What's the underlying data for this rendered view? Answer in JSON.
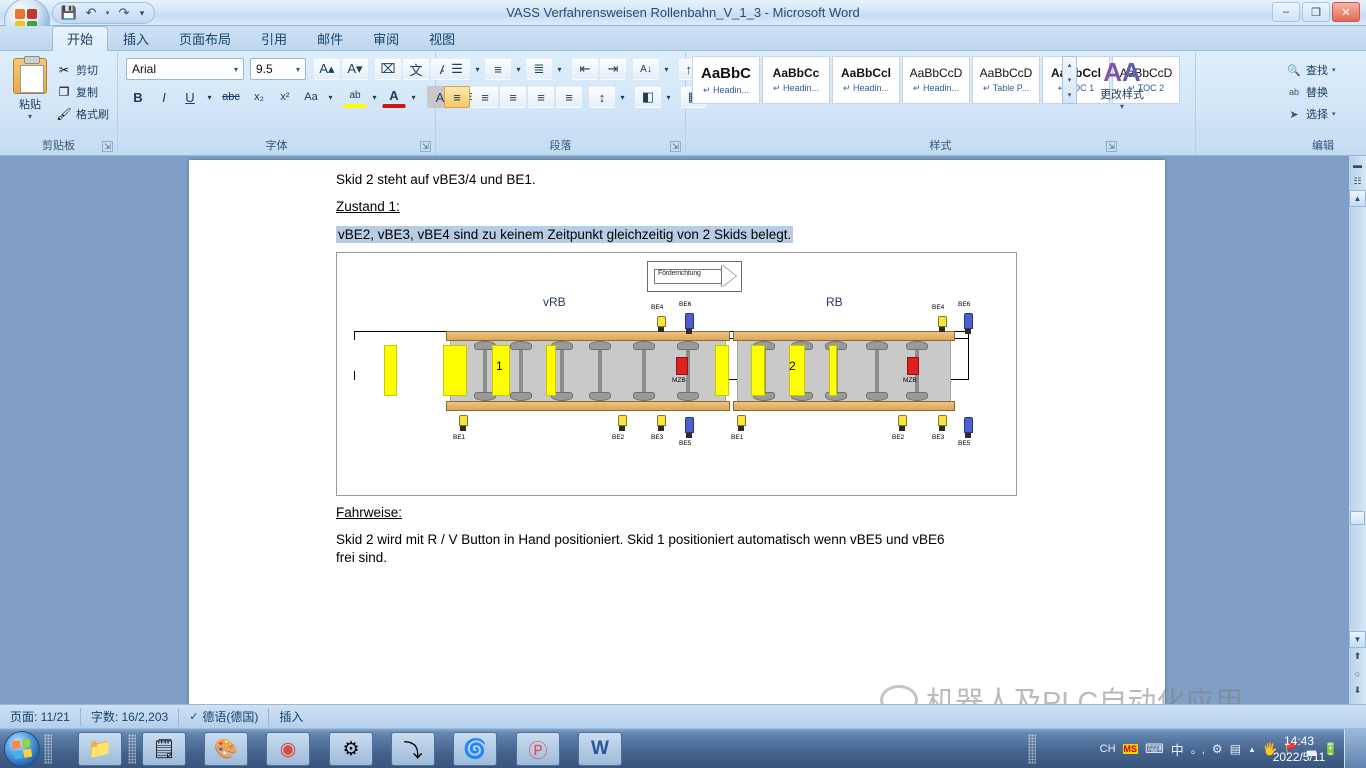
{
  "window": {
    "title": "VASS Verfahrensweisen Rollenbahn_V_1_3 - Microsoft Word",
    "minimize": "–",
    "maximize": "❐",
    "close": "✕"
  },
  "quick_access": {
    "save": "💾",
    "undo": "↶",
    "undo_arrow": "▾",
    "redo": "↷",
    "customize": "▾"
  },
  "ribbon": {
    "tabs": [
      {
        "label": "开始",
        "active": true
      },
      {
        "label": "插入",
        "active": false
      },
      {
        "label": "页面布局",
        "active": false
      },
      {
        "label": "引用",
        "active": false
      },
      {
        "label": "邮件",
        "active": false
      },
      {
        "label": "审阅",
        "active": false
      },
      {
        "label": "视图",
        "active": false
      }
    ],
    "clipboard": {
      "group_label": "剪贴板",
      "paste": "粘贴",
      "paste_arrow": "▾",
      "cut": "剪切",
      "copy": "复制",
      "format_painter": "格式刷",
      "cut_icon": "✂",
      "copy_icon": "❐",
      "painter_icon": "🖌"
    },
    "font": {
      "group_label": "字体",
      "font_name": "Arial",
      "font_size": "9.5",
      "grow": "A▴",
      "shrink": "A▾",
      "clear_format": "⌧",
      "phonetic": "文",
      "char_border": "A",
      "bold": "B",
      "italic": "I",
      "underline": "U",
      "underline_arrow": "▾",
      "strike": "abc",
      "subscript": "x₂",
      "superscript": "x²",
      "change_case": "Aa",
      "case_arrow": "▾",
      "highlight": "ab",
      "highlight_arrow": "▾",
      "font_color": "A",
      "color_arrow": "▾",
      "shading_char": "A",
      "enclose_char": "字"
    },
    "paragraph": {
      "group_label": "段落",
      "bullets": "☰",
      "numbering": "≡",
      "multilevel": "≣",
      "decrease_indent": "⇤",
      "increase_indent": "⇥",
      "sort": "↑↓",
      "sort_az": "A↓",
      "show_marks": "¶",
      "align_left": "≡",
      "align_center": "≡",
      "align_right": "≡",
      "justify": "≡",
      "distribute": "≡",
      "line_spacing": "↕",
      "shading": "◧",
      "borders": "▦",
      "arrow": "▾"
    },
    "styles": {
      "group_label": "样式",
      "items": [
        {
          "preview": "AaBbC",
          "name": "↵ Headin...",
          "bold": true,
          "big": true
        },
        {
          "preview": "AaBbCc",
          "name": "↵ Headin...",
          "bold": true,
          "big": true
        },
        {
          "preview": "AaBbCcl",
          "name": "↵ Headin...",
          "bold": true,
          "big": false
        },
        {
          "preview": "AaBbCcD",
          "name": "↵ Headin...",
          "bold": false,
          "big": false
        },
        {
          "preview": "AaBbCcD",
          "name": "↵ Table P...",
          "bold": false,
          "big": false
        },
        {
          "preview": "AaBbCcl",
          "name": "↵ TOC 1",
          "bold": true,
          "big": false
        },
        {
          "preview": "AaBbCcD",
          "name": "↵ TOC 2",
          "bold": false,
          "big": false
        }
      ],
      "scroll_up": "▴",
      "scroll_down": "▾",
      "more": "▾",
      "change_styles": "更改样式",
      "change_styles_arrow": "▾"
    },
    "editing": {
      "group_label": "编辑",
      "find": "查找",
      "find_icon": "🔍",
      "find_arrow": "▾",
      "replace": "替换",
      "replace_icon": "ab",
      "select": "选择",
      "select_icon": "➤",
      "select_arrow": "▾"
    }
  },
  "document": {
    "line1": "Skid 2 steht  auf vBE3/4 und  BE1.",
    "line2": "Zustand 1:",
    "line3": "vBE2, vBE3, vBE4 sind  zu keinem Zeitpunkt  gleichzeitig  von 2 Skids belegt.",
    "line4": "Fahrweise:",
    "line5": "Skid 2 wird mit R / V Button in Hand positioniert.  Skid 1 positioniert  automatisch wenn  vBE5 und  vBE6",
    "line6": "frei sind."
  },
  "diagram": {
    "direction_label": "Förderrichtung",
    "left_conveyor_label": "vRB",
    "right_conveyor_label": "RB",
    "left_skid_number": "1",
    "right_skid_number": "2",
    "motor_label_left": "MZB",
    "motor_label_right": "MZB",
    "sensors_left": [
      "BE1",
      "BE2",
      "BE3",
      "BE4",
      "BE5",
      "BE6"
    ],
    "sensors_right": [
      "BE1",
      "BE2",
      "BE3",
      "BE4",
      "BE5",
      "BE6"
    ]
  },
  "status_bar": {
    "page": "页面: 11/21",
    "words": "字数: 16/2,203",
    "proof_icon": "✔",
    "language": "德语(德国)",
    "insert_mode": "插入"
  },
  "watermark": {
    "text": "机器人及PLC自动化应用"
  },
  "taskbar": {
    "buttons": [
      {
        "name": "explorer",
        "glyph": "📁"
      },
      {
        "name": "calculator",
        "glyph": "🗒"
      },
      {
        "name": "media-app",
        "glyph": "🎨"
      },
      {
        "name": "chrome",
        "glyph": "◉"
      },
      {
        "name": "plc-editor",
        "glyph": "⚙"
      },
      {
        "name": "chart-app",
        "glyph": "⤵"
      },
      {
        "name": "office-app",
        "glyph": "🌀"
      },
      {
        "name": "pdf-app",
        "glyph": "Ⓟ"
      },
      {
        "name": "word-doc",
        "glyph": "W"
      }
    ],
    "tray": {
      "ime_ch": "CH",
      "ime_ms": "MS",
      "ime_mode": "中",
      "ime_punct": "。,",
      "ime_tool": "⚙",
      "ime_pad": "⌨",
      "overflow": "▲",
      "action_center": "🖐",
      "network": "🚩",
      "signal": "▃",
      "battery": "🔋"
    },
    "clock_time": "14:43",
    "clock_date": "2022/5/11"
  },
  "scrollbar": {
    "up": "▲",
    "down": "▼",
    "prev_page": "⬆",
    "select_object": "○",
    "next_page": "⬇"
  }
}
